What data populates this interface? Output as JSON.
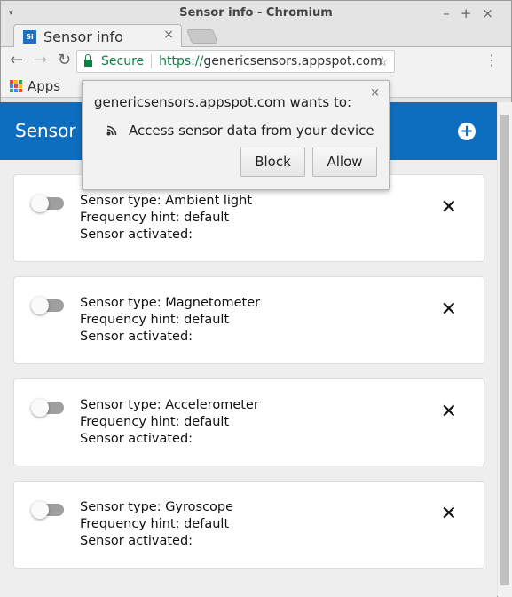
{
  "window": {
    "title": "Sensor info - Chromium",
    "menu_icon": "▾",
    "controls": "–+×"
  },
  "tab": {
    "favicon": "Si",
    "label": "Sensor info",
    "close": "×"
  },
  "toolbar": {
    "back": "←",
    "forward": "→",
    "reload": "↻",
    "secure": "Secure",
    "scheme": "https://",
    "host": "genericsensors.appspot.com",
    "star": "☆",
    "menu": "⋮"
  },
  "bookmarks": {
    "apps": "Apps"
  },
  "app": {
    "title": "Sensor info",
    "add": "+"
  },
  "cards": [
    {
      "type": "Sensor type: Ambient light",
      "freq": "Frequency hint: default",
      "activated": "Sensor activated:"
    },
    {
      "type": "Sensor type: Magnetometer",
      "freq": "Frequency hint: default",
      "activated": "Sensor activated:"
    },
    {
      "type": "Sensor type: Accelerometer",
      "freq": "Frequency hint: default",
      "activated": "Sensor activated:"
    },
    {
      "type": "Sensor type: Gyroscope",
      "freq": "Frequency hint: default",
      "activated": "Sensor activated:"
    }
  ],
  "card_close": "✕",
  "popup": {
    "title": "genericsensors.appspot.com wants to:",
    "close": "×",
    "permission": "Access sensor data from your device",
    "block": "Block",
    "allow": "Allow"
  },
  "colors": {
    "accent": "#0d6ebf",
    "secure": "#0b8043"
  }
}
